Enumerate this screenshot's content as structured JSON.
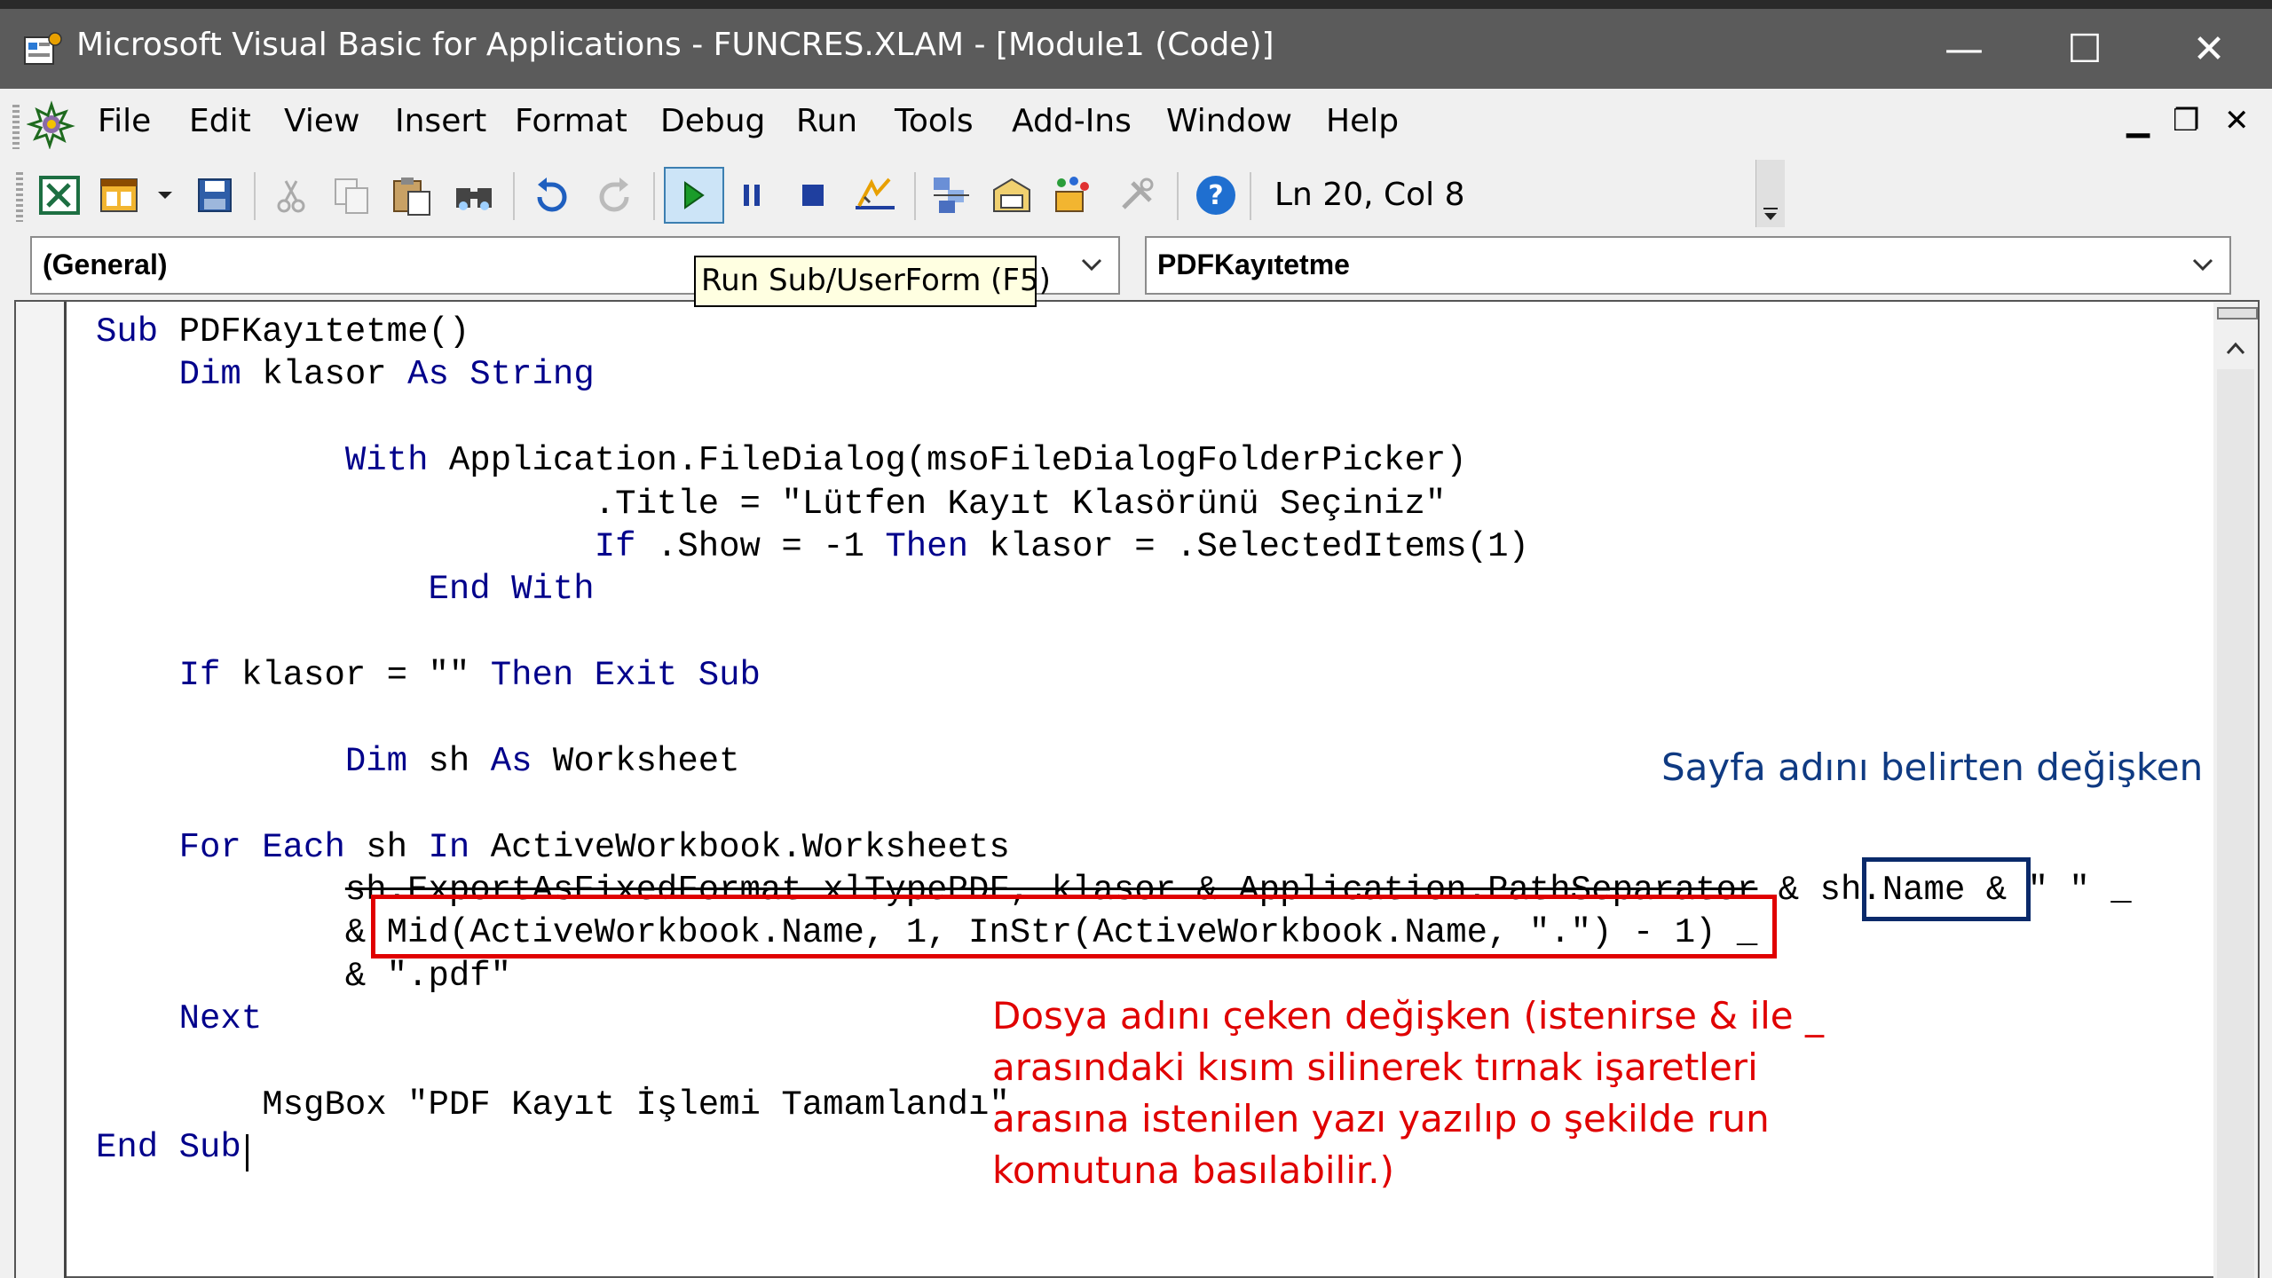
{
  "window": {
    "title": "Microsoft Visual Basic for Applications - FUNCRES.XLAM - [Module1 (Code)]",
    "controls": {
      "minimize": "—",
      "maximize": "☐",
      "close": "✕"
    }
  },
  "menu": {
    "items": [
      {
        "id": "file",
        "label": "File"
      },
      {
        "id": "edit",
        "label": "Edit"
      },
      {
        "id": "view",
        "label": "View"
      },
      {
        "id": "insert",
        "label": "Insert"
      },
      {
        "id": "format",
        "label": "Format"
      },
      {
        "id": "debug",
        "label": "Debug"
      },
      {
        "id": "run",
        "label": "Run"
      },
      {
        "id": "tools",
        "label": "Tools"
      },
      {
        "id": "addins",
        "label": "Add-Ins"
      },
      {
        "id": "window",
        "label": "Window"
      },
      {
        "id": "help",
        "label": "Help"
      }
    ],
    "mdi": {
      "minimize": "▁",
      "restore": "❐",
      "close": "✕"
    }
  },
  "toolbar": {
    "icons": [
      "excel-view-icon",
      "insert-userform-icon",
      "save-icon",
      "cut-icon",
      "copy-icon",
      "paste-icon",
      "find-icon",
      "undo-icon",
      "redo-icon",
      "run-icon",
      "break-icon",
      "reset-icon",
      "design-mode-icon",
      "project-explorer-icon",
      "properties-window-icon",
      "object-browser-icon",
      "toolbox-icon",
      "help-icon"
    ],
    "status": "Ln 20, Col 8"
  },
  "object_combo": {
    "value": "(General)"
  },
  "procedure_combo": {
    "value": "PDFKayıtetme"
  },
  "tooltip": "Run Sub/UserForm (F5)",
  "code_lines": [
    [
      {
        "t": "kw",
        "v": "Sub"
      },
      {
        "t": "n",
        "v": " PDFKayıtetme()"
      }
    ],
    [
      {
        "t": "n",
        "v": "    "
      },
      {
        "t": "kw",
        "v": "Dim"
      },
      {
        "t": "n",
        "v": " klasor "
      },
      {
        "t": "kw",
        "v": "As"
      },
      {
        "t": "n",
        "v": " "
      },
      {
        "t": "kw",
        "v": "String"
      }
    ],
    [],
    [
      {
        "t": "n",
        "v": "            "
      },
      {
        "t": "kw",
        "v": "With"
      },
      {
        "t": "n",
        "v": " Application.FileDialog(msoFileDialogFolderPicker)"
      }
    ],
    [
      {
        "t": "n",
        "v": "                        .Title = \"Lütfen Kayıt Klasörünü Seçiniz\""
      }
    ],
    [
      {
        "t": "n",
        "v": "                        "
      },
      {
        "t": "kw",
        "v": "If"
      },
      {
        "t": "n",
        "v": " .Show = -1 "
      },
      {
        "t": "kw",
        "v": "Then"
      },
      {
        "t": "n",
        "v": " klasor = .SelectedItems(1)"
      }
    ],
    [
      {
        "t": "n",
        "v": "                "
      },
      {
        "t": "kw",
        "v": "End With"
      }
    ],
    [],
    [
      {
        "t": "n",
        "v": "    "
      },
      {
        "t": "kw",
        "v": "If"
      },
      {
        "t": "n",
        "v": " klasor = \"\" "
      },
      {
        "t": "kw",
        "v": "Then Exit Sub"
      }
    ],
    [],
    [
      {
        "t": "n",
        "v": "            "
      },
      {
        "t": "kw",
        "v": "Dim"
      },
      {
        "t": "n",
        "v": " sh "
      },
      {
        "t": "kw",
        "v": "As"
      },
      {
        "t": "n",
        "v": " Worksheet"
      }
    ],
    [],
    [
      {
        "t": "n",
        "v": "    "
      },
      {
        "t": "kw",
        "v": "For Each"
      },
      {
        "t": "n",
        "v": " sh "
      },
      {
        "t": "kw",
        "v": "In"
      },
      {
        "t": "n",
        "v": " ActiveWorkbook.Worksheets"
      }
    ],
    [
      {
        "t": "n",
        "v": "            "
      },
      {
        "t": "s",
        "v": "sh.ExportAsFixedFormat xlTypePDF, klasor & Application.PathSeparator"
      },
      {
        "t": "n",
        "v": " & sh.Name & \" \" _"
      }
    ],
    [
      {
        "t": "n",
        "v": "            & Mid(ActiveWorkbook.Name, 1, InStr(ActiveWorkbook.Name, \".\") - 1) _"
      }
    ],
    [
      {
        "t": "n",
        "v": "            & \".pdf\""
      }
    ],
    [
      {
        "t": "n",
        "v": "    "
      },
      {
        "t": "kw",
        "v": "Next"
      }
    ],
    [],
    [
      {
        "t": "n",
        "v": "        MsgBox \"PDF Kayıt İşlemi Tamamlandı\""
      }
    ],
    [
      {
        "t": "kw",
        "v": "End Sub"
      }
    ]
  ],
  "annotations": {
    "variable_label": "Sayfa adını belirten değişken",
    "filename_note": "Dosya adını çeken değişken (istenirse & ile _ arasındaki kısım silinerek tırnak işaretleri arasına istenilen yazı yazılıp o şekilde run komutuna basılabilir.)",
    "red_color": "#e00000",
    "blue_color": "#0f3a82"
  }
}
